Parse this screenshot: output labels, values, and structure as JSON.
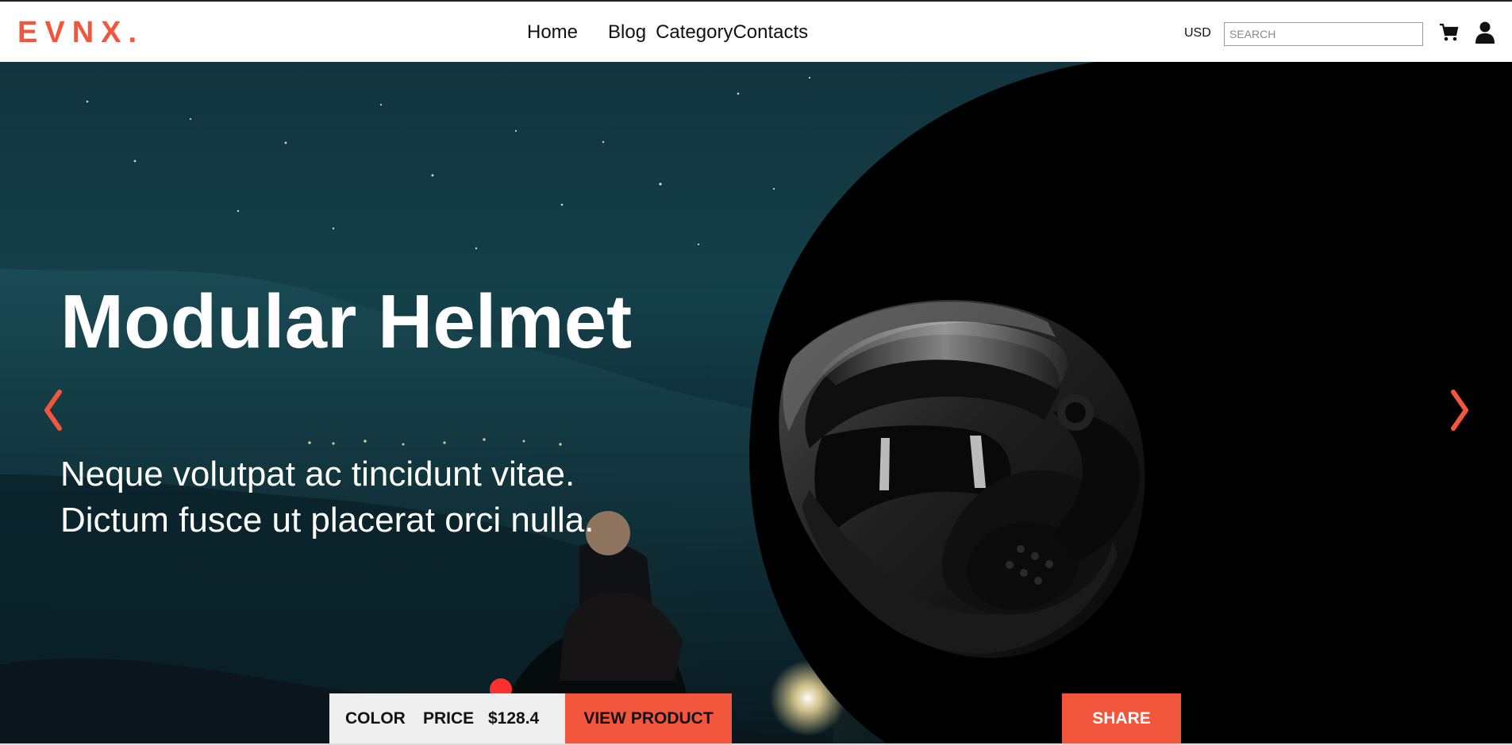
{
  "header": {
    "logo": "EVNX.",
    "nav": {
      "home": "Home",
      "blog": "Blog",
      "category": "Category",
      "contacts": "Contacts"
    },
    "currency": "USD",
    "search_placeholder": "SEARCH"
  },
  "hero": {
    "title": "Modular Helmet",
    "subtitle_line_1": "Neque volutpat ac tincidunt vitae.",
    "subtitle_line_2": "Dictum fusce ut placerat orci nulla.",
    "arrow_left": "‹",
    "arrow_right": "›"
  },
  "product_bar": {
    "color_label": "COLOR",
    "price_label": "PRICE",
    "price_value": "$128.4",
    "view_product_label": "VIEW PRODUCT"
  },
  "share": {
    "label": "SHARE"
  },
  "icons": {
    "cart": "cart-icon",
    "user": "user-icon",
    "left_arrow": "chevron-left-icon",
    "right_arrow": "chevron-right-icon",
    "helmet": "helmet-icon"
  },
  "colors": {
    "accent": "#f2563d",
    "text_dark": "#111111",
    "hero_night": "#12343d"
  }
}
